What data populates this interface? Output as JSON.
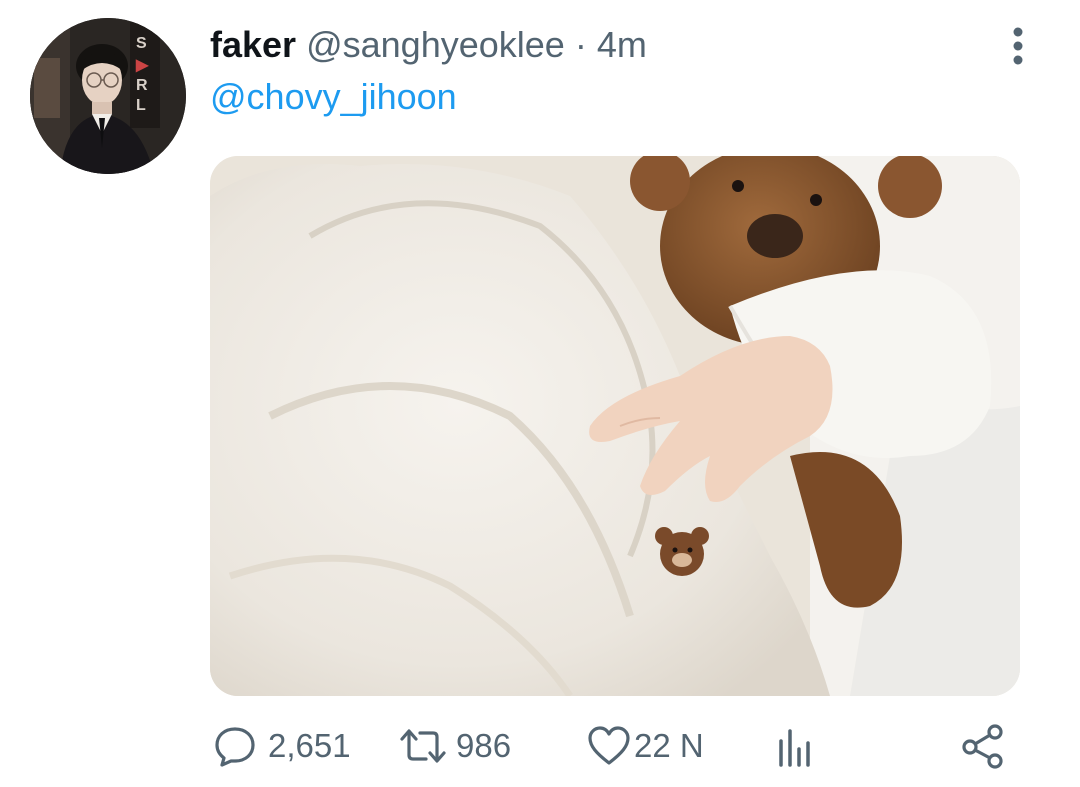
{
  "tweet": {
    "display_name": "faker",
    "handle": "@sanghyeoklee",
    "separator": "·",
    "time": "4m",
    "text": "@chovy_jihoon",
    "avatar_icon": "profile-photo",
    "more_icon": "more-vertical-icon",
    "media_icon": "photo-teddy-bear-blanket"
  },
  "actions": {
    "reply_count": "2,651",
    "retweet_count": "986",
    "like_count": "22 N",
    "reply_icon": "comment-icon",
    "retweet_icon": "retweet-icon",
    "like_icon": "heart-icon",
    "views_icon": "views-chart-icon",
    "share_icon": "share-icon"
  },
  "colors": {
    "link": "#1d9bf0",
    "muted": "#536471",
    "text": "#0f1419"
  }
}
